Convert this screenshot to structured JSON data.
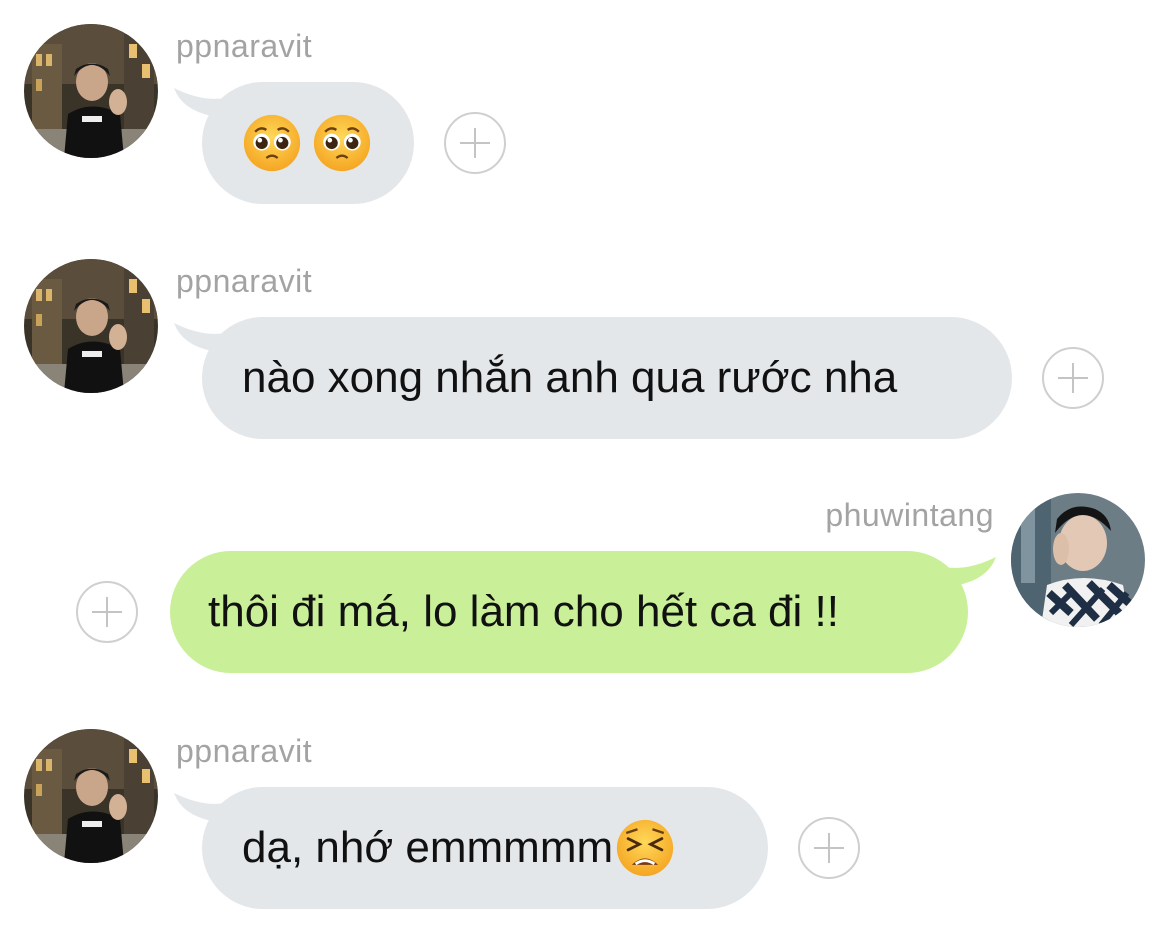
{
  "conversation": {
    "messages": [
      {
        "sender": "ppnaravit",
        "direction": "incoming",
        "text": "",
        "emojis": [
          "pleading-face-emoji",
          "pleading-face-emoji"
        ]
      },
      {
        "sender": "ppnaravit",
        "direction": "incoming",
        "text": "nào xong nhắn anh qua rước nha",
        "emojis": []
      },
      {
        "sender": "phuwintang",
        "direction": "outgoing",
        "text": "thôi đi má, lo làm cho hết ca đi !!",
        "emojis": []
      },
      {
        "sender": "ppnaravit",
        "direction": "incoming",
        "text": "dạ, nhớ emmmmm",
        "emojis": [
          "tired-face-emoji"
        ]
      }
    ]
  },
  "colors": {
    "incoming_bubble": "#e4e7ea",
    "outgoing_bubble": "#c9f098",
    "sender_name": "#a3a3a3",
    "message_text": "#111111",
    "reaction_button": "#cfcfcf"
  }
}
